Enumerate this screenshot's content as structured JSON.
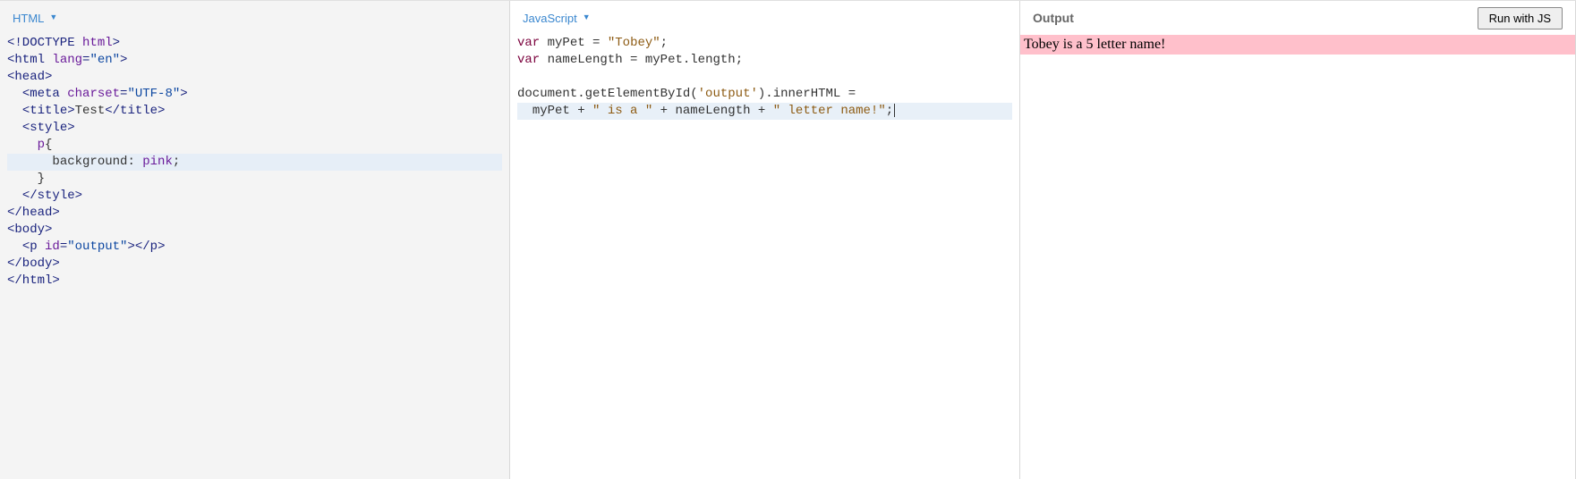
{
  "panels": {
    "html": {
      "label": "HTML"
    },
    "js": {
      "label": "JavaScript"
    },
    "output": {
      "label": "Output",
      "run_button": "Run with JS"
    }
  },
  "html_code": {
    "lines": [
      {
        "tokens": [
          [
            "tag",
            "<!DOCTYPE "
          ],
          [
            "attr",
            "html"
          ],
          [
            "tag",
            ">"
          ]
        ]
      },
      {
        "tokens": [
          [
            "tag",
            "<html "
          ],
          [
            "attr",
            "lang"
          ],
          [
            "tag",
            "="
          ],
          [
            "str",
            "\"en\""
          ],
          [
            "tag",
            ">"
          ]
        ]
      },
      {
        "tokens": [
          [
            "tag",
            "<head>"
          ]
        ]
      },
      {
        "tokens": [
          [
            "punct",
            "  "
          ],
          [
            "tag",
            "<meta "
          ],
          [
            "attr",
            "charset"
          ],
          [
            "tag",
            "="
          ],
          [
            "str",
            "\"UTF-8\""
          ],
          [
            "tag",
            ">"
          ]
        ]
      },
      {
        "tokens": [
          [
            "punct",
            "  "
          ],
          [
            "tag",
            "<title>"
          ],
          [
            "punct",
            "Test"
          ],
          [
            "tag",
            "</title>"
          ]
        ]
      },
      {
        "tokens": [
          [
            "punct",
            "  "
          ],
          [
            "tag",
            "<style>"
          ]
        ]
      },
      {
        "tokens": [
          [
            "punct",
            "    "
          ],
          [
            "sel",
            "p"
          ],
          [
            "punct",
            "{"
          ]
        ]
      },
      {
        "highlight": true,
        "tokens": [
          [
            "punct",
            "      "
          ],
          [
            "prop",
            "background"
          ],
          [
            "punct",
            ": "
          ],
          [
            "val",
            "pink"
          ],
          [
            "punct",
            ";"
          ]
        ]
      },
      {
        "tokens": [
          [
            "punct",
            "    }"
          ]
        ]
      },
      {
        "tokens": [
          [
            "punct",
            "  "
          ],
          [
            "tag",
            "</style>"
          ]
        ]
      },
      {
        "tokens": [
          [
            "tag",
            "</head>"
          ]
        ]
      },
      {
        "tokens": [
          [
            "tag",
            "<body>"
          ]
        ]
      },
      {
        "tokens": [
          [
            "punct",
            "  "
          ],
          [
            "tag",
            "<p "
          ],
          [
            "attr",
            "id"
          ],
          [
            "tag",
            "="
          ],
          [
            "str",
            "\"output\""
          ],
          [
            "tag",
            "></p>"
          ]
        ]
      },
      {
        "tokens": [
          [
            "tag",
            "</body>"
          ]
        ]
      },
      {
        "tokens": [
          [
            "tag",
            "</html>"
          ]
        ]
      }
    ]
  },
  "js_code": {
    "lines": [
      {
        "tokens": [
          [
            "kw",
            "var"
          ],
          [
            "punct",
            " "
          ],
          [
            "ident",
            "myPet"
          ],
          [
            "punct",
            " = "
          ],
          [
            "strbrown",
            "\"Tobey\""
          ],
          [
            "punct",
            ";"
          ]
        ]
      },
      {
        "tokens": [
          [
            "kw",
            "var"
          ],
          [
            "punct",
            " "
          ],
          [
            "ident",
            "nameLength"
          ],
          [
            "punct",
            " = "
          ],
          [
            "ident",
            "myPet"
          ],
          [
            "punct",
            "."
          ],
          [
            "ident",
            "length"
          ],
          [
            "punct",
            ";"
          ]
        ]
      },
      {
        "tokens": []
      },
      {
        "tokens": [
          [
            "ident",
            "document"
          ],
          [
            "punct",
            "."
          ],
          [
            "func",
            "getElementById"
          ],
          [
            "punct",
            "("
          ],
          [
            "strbrown",
            "'output'"
          ],
          [
            "punct",
            ")."
          ],
          [
            "ident",
            "innerHTML"
          ],
          [
            "punct",
            " ="
          ]
        ]
      },
      {
        "highlight": true,
        "cursor": true,
        "tokens": [
          [
            "punct",
            "  "
          ],
          [
            "ident",
            "myPet"
          ],
          [
            "punct",
            " + "
          ],
          [
            "strbrown",
            "\" is a \""
          ],
          [
            "punct",
            " + "
          ],
          [
            "ident",
            "nameLength"
          ],
          [
            "punct",
            " + "
          ],
          [
            "strbrown",
            "\" letter name!\""
          ],
          [
            "punct",
            ";"
          ]
        ]
      }
    ]
  },
  "output_result": "Tobey is a 5 letter name!"
}
